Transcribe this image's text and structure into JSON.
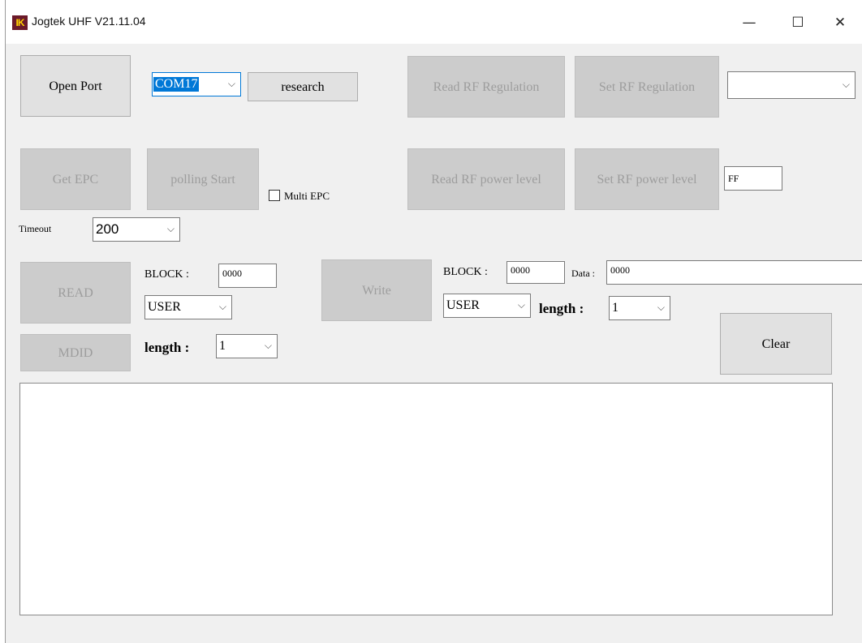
{
  "window": {
    "title": "Jogtek UHF V21.11.04",
    "icon_text": "IK",
    "controls": {
      "minimize": "—",
      "maximize": "☐",
      "close": "✕"
    }
  },
  "port": {
    "open_label": "Open Port",
    "com_value": "COM17",
    "research_label": "research"
  },
  "rf": {
    "read_regulation_label": "Read RF Regulation",
    "set_regulation_label": "Set RF Regulation",
    "regulation_value": "",
    "read_power_label": "Read RF power level",
    "set_power_label": "Set RF power level",
    "power_value": "FF"
  },
  "epc": {
    "get_epc_label": "Get EPC",
    "polling_label": "polling Start",
    "multi_epc_label": "Multi EPC",
    "timeout_label": "Timeout",
    "timeout_value": "200"
  },
  "read_section": {
    "read_label": "READ",
    "mdid_label": "MDID",
    "block_label": "BLOCK :",
    "block_value": "0000",
    "bank_value": "USER",
    "length_label": "length :",
    "length_value": "1"
  },
  "write_section": {
    "write_label": "Write",
    "block_label": "BLOCK :",
    "block_value": "0000",
    "data_label": "Data :",
    "data_value": "0000",
    "bank_value": "USER",
    "length_label": "length :",
    "length_value": "1"
  },
  "clear_label": "Clear",
  "log_text": "",
  "icons": {
    "dropdown": "chevron-down-icon"
  }
}
